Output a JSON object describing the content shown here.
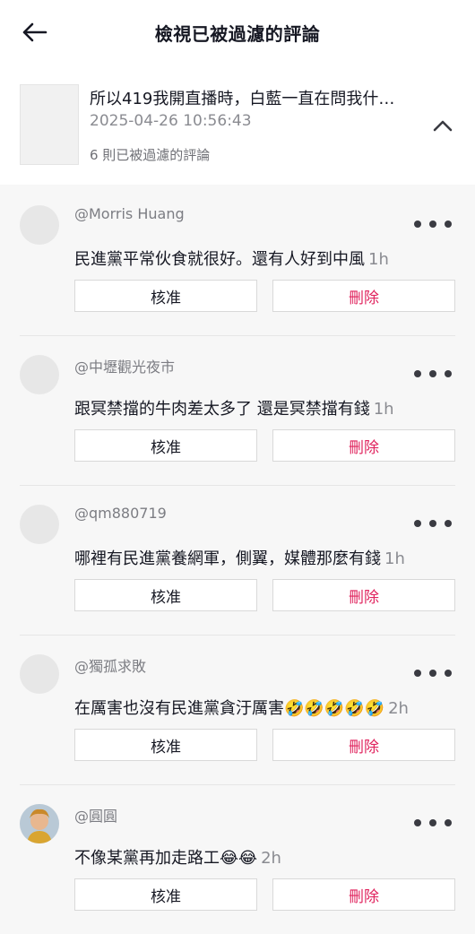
{
  "header": {
    "title": "檢視已被過濾的評論"
  },
  "video": {
    "caption": "所以419我開直播時，白藍一直在問我什…",
    "date": "2025-04-26 10:56:43",
    "filtered_count": "6 則已被過濾的評論"
  },
  "colors": {
    "delete": "#e0245e",
    "muted": "#8a8b91"
  },
  "comments": [
    {
      "username": "@Morris Huang",
      "text": "民進黨平常伙食就很好。還有人好到中風",
      "time": "1h",
      "approve_label": "核准",
      "delete_label": "刪除"
    },
    {
      "username": "@中壢觀光夜市",
      "text": "跟冥禁擋的牛肉差太多了 還是冥禁擋有錢",
      "time": "1h",
      "approve_label": "核准",
      "delete_label": "刪除"
    },
    {
      "username": "@qm880719",
      "text": "哪裡有民進黨養網軍，側翼，媒體那麼有錢",
      "time": "1h",
      "approve_label": "核准",
      "delete_label": "刪除"
    },
    {
      "username": "@獨孤求敗",
      "text": "在厲害也沒有民進黨貪汙厲害🤣🤣🤣🤣🤣",
      "time": "2h",
      "approve_label": "核准",
      "delete_label": "刪除"
    },
    {
      "username": "@圓圓",
      "text": "不像某黨再加走路工😂😂",
      "time": "2h",
      "approve_label": "核准",
      "delete_label": "刪除"
    }
  ]
}
